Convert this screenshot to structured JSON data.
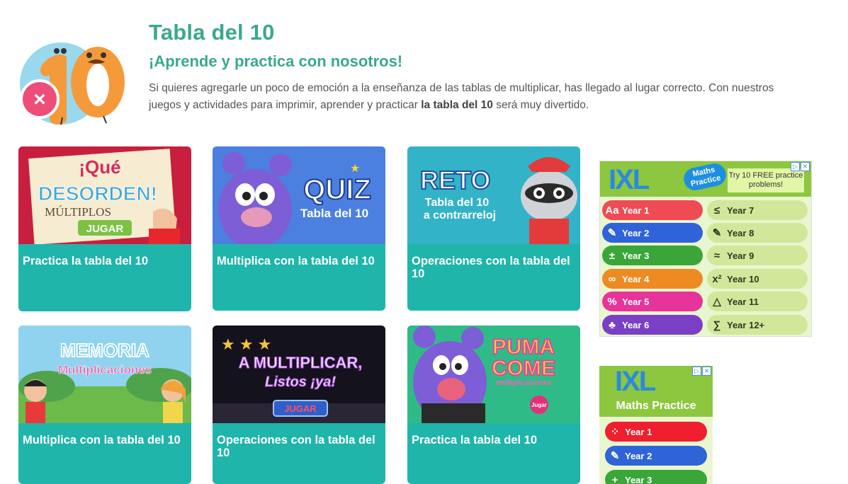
{
  "header": {
    "title": "Tabla del 10",
    "subtitle": "¡Aprende y practica con nosotros!",
    "intro_pre": "Si quieres agregarle un poco de emoción a la enseñanza de las tablas de multiplicar, has llegado al lugar correcto. Con nuestros juegos y actividades para imprimir, aprender y practicar ",
    "intro_bold": "la tabla del 10",
    "intro_post": " será muy divertido.",
    "logo_text": "10"
  },
  "cards": [
    {
      "title": "Practica la tabla del 10",
      "art": [
        "¡Qué",
        "DESORDEN!",
        "MÚLTIPLOS",
        "JUGAR"
      ]
    },
    {
      "title": "Multiplica con la tabla del 10",
      "art": [
        "QUIZ",
        "Tabla del 10"
      ]
    },
    {
      "title": "Operaciones con la tabla del 10",
      "art": [
        "RETO",
        "Tabla del 10",
        "a contrarreloj"
      ]
    },
    {
      "title": "Multiplica con la tabla del 10",
      "art": [
        "MEMORIA",
        "Multiplicaciones"
      ]
    },
    {
      "title": "Operaciones con la tabla del 10",
      "art": [
        "A MULTIPLICAR,",
        "Listos ¡ya!",
        "JUGAR"
      ]
    },
    {
      "title": "Practica la tabla del 10",
      "art": [
        "PUMA",
        "COME",
        "multiplicaciones",
        "Jugar"
      ]
    }
  ],
  "ad1": {
    "brand": "IXL",
    "badge": "Maths Practice",
    "promo": "Try 10 FREE practice problems!",
    "left": [
      {
        "label": "Year 1",
        "icon": "Aa",
        "color": "#ef4b55"
      },
      {
        "label": "Year 2",
        "icon": "✎",
        "color": "#2f63d8"
      },
      {
        "label": "Year 3",
        "icon": "±",
        "color": "#3aa63a"
      },
      {
        "label": "Year 4",
        "icon": "∞",
        "color": "#ee8a22"
      },
      {
        "label": "Year 5",
        "icon": "%",
        "color": "#e6349a"
      },
      {
        "label": "Year 6",
        "icon": "♣",
        "color": "#7b3fc5"
      }
    ],
    "right": [
      {
        "label": "Year 7",
        "icon": "≤"
      },
      {
        "label": "Year 8",
        "icon": "✎"
      },
      {
        "label": "Year 9",
        "icon": "≈"
      },
      {
        "label": "Year 10",
        "icon": "x²"
      },
      {
        "label": "Year 11",
        "icon": "△"
      },
      {
        "label": "Year 12+",
        "icon": "∑"
      }
    ]
  },
  "ad2": {
    "brand": "IXL",
    "subtitle": "Maths Practice",
    "items": [
      {
        "label": "Year 1",
        "icon": "⁘",
        "color": "#ef1f2d"
      },
      {
        "label": "Year 2",
        "icon": "✎",
        "color": "#2f63d8"
      },
      {
        "label": "Year 3",
        "icon": "+",
        "color": "#3aa63a"
      }
    ]
  },
  "adchoices": {
    "info": "▷",
    "close": "✕"
  }
}
